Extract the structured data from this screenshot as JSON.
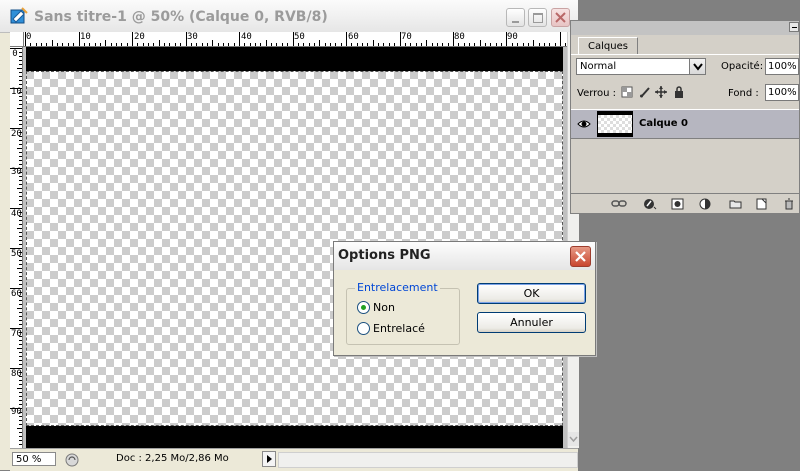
{
  "document": {
    "title": "Sans titre-1 @ 50% (Calque 0, RVB/8)",
    "ruler_h_labels": [
      "0",
      "10",
      "20",
      "30",
      "40",
      "50",
      "60",
      "70",
      "80",
      "90"
    ],
    "ruler_v_labels": [
      "0",
      "10",
      "20",
      "30",
      "40",
      "50",
      "60",
      "70",
      "80",
      "90"
    ],
    "zoom": "50 %",
    "doc_info": "Doc : 2,25 Mo/2,86 Mo"
  },
  "layers_panel": {
    "tab": "Calques",
    "blend_mode": "Normal",
    "opacity_label": "Opacité:",
    "opacity_value": "100%",
    "lock_label": "Verrou :",
    "fill_label": "Fond :",
    "fill_value": "100%",
    "layers": [
      {
        "name": "Calque 0",
        "visible": true
      }
    ]
  },
  "png_dialog": {
    "title": "Options PNG",
    "group_label": "Entrelacement",
    "options": [
      {
        "label": "Non",
        "checked": true
      },
      {
        "label": "Entrelacé",
        "checked": false
      }
    ],
    "ok_label": "OK",
    "cancel_label": "Annuler"
  },
  "colors": {
    "desktop": "#808080",
    "dialog_close": "#c9462f",
    "group_label": "#0046d5",
    "radio_checked": "#21a121"
  }
}
